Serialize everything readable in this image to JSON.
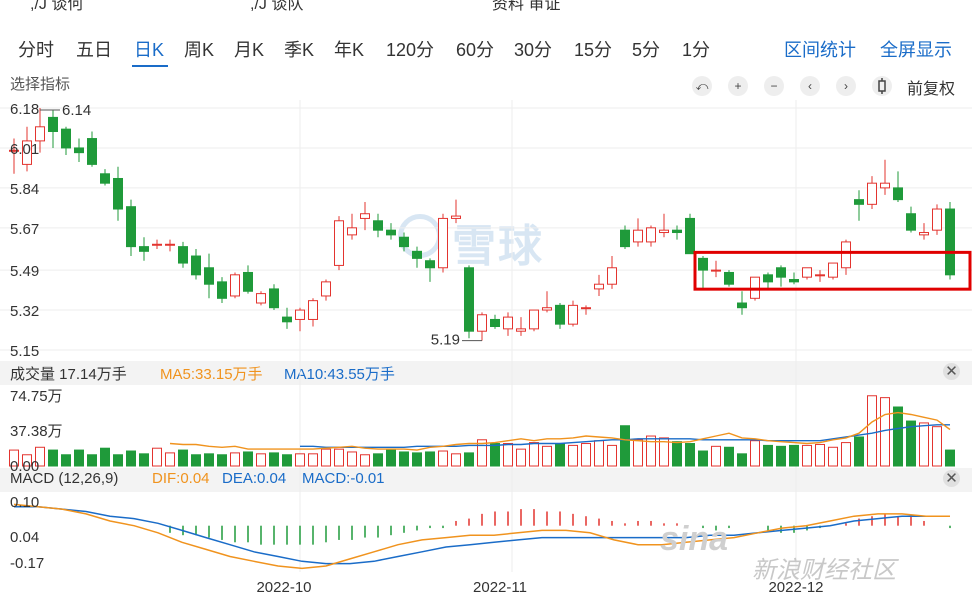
{
  "tabs": [
    "分时",
    "五日",
    "日K",
    "周K",
    "月K",
    "季K",
    "年K",
    "120分",
    "60分",
    "30分",
    "15分",
    "5分",
    "1分"
  ],
  "active_tab": "日K",
  "right_links": {
    "range_stats": "区间统计",
    "fullscreen": "全屏显示"
  },
  "indicator_select": "选择指标",
  "controls": {
    "undo": "⤺",
    "zoom_in": "+",
    "zoom_out": "−",
    "prev": "‹",
    "next": "›"
  },
  "adjust_label": "前复权",
  "volume_bar": {
    "label": "成交量 17.14万手",
    "ma5": "MA5:33.15万手",
    "ma10": "MA10:43.55万手"
  },
  "macd_bar": {
    "label": "MACD (12,26,9)",
    "dif": "DIF:0.04",
    "dea": "DEA:0.04",
    "macd": "MACD:-0.01"
  },
  "watermarks": {
    "xueqiu": "雪球",
    "sina_logo": "sina",
    "sina_text": "新浪财经社区"
  },
  "colors": {
    "up": "#e3342f",
    "down": "#1f9a3a",
    "ma5": "#f0931e",
    "ma10": "#1a6cc8",
    "highlight": "#e00000",
    "accent": "#1a6cc8"
  },
  "chart_data": [
    {
      "type": "candlestick",
      "ylim": [
        5.15,
        6.18
      ],
      "y_ticks": [
        "6.18",
        "6.01",
        "5.84",
        "5.67",
        "5.49",
        "5.32",
        "5.15"
      ],
      "annotations": {
        "high": "6.14",
        "low": "5.19"
      },
      "x_labels": [
        "2022-10",
        "2022-11",
        "2022-12"
      ],
      "ohlc": [
        [
          6.0,
          6.05,
          5.9,
          6.0
        ],
        [
          5.94,
          6.1,
          5.91,
          6.04
        ],
        [
          6.04,
          6.18,
          5.99,
          6.1
        ],
        [
          6.14,
          6.17,
          6.01,
          6.08
        ],
        [
          6.09,
          6.1,
          5.98,
          6.01
        ],
        [
          6.01,
          6.05,
          5.95,
          5.99
        ],
        [
          6.05,
          6.08,
          5.93,
          5.94
        ],
        [
          5.9,
          5.92,
          5.85,
          5.86
        ],
        [
          5.88,
          5.93,
          5.7,
          5.75
        ],
        [
          5.76,
          5.79,
          5.55,
          5.59
        ],
        [
          5.59,
          5.63,
          5.53,
          5.57
        ],
        [
          5.6,
          5.62,
          5.58,
          5.6
        ],
        [
          5.6,
          5.62,
          5.57,
          5.6
        ],
        [
          5.59,
          5.61,
          5.5,
          5.52
        ],
        [
          5.55,
          5.58,
          5.45,
          5.47
        ],
        [
          5.5,
          5.56,
          5.37,
          5.43
        ],
        [
          5.44,
          5.46,
          5.35,
          5.37
        ],
        [
          5.38,
          5.48,
          5.37,
          5.47
        ],
        [
          5.48,
          5.51,
          5.39,
          5.4
        ],
        [
          5.35,
          5.4,
          5.34,
          5.39
        ],
        [
          5.41,
          5.43,
          5.32,
          5.33
        ],
        [
          5.29,
          5.33,
          5.24,
          5.27
        ],
        [
          5.28,
          5.33,
          5.23,
          5.32
        ],
        [
          5.28,
          5.37,
          5.25,
          5.36
        ],
        [
          5.38,
          5.45,
          5.36,
          5.44
        ],
        [
          5.51,
          5.72,
          5.49,
          5.7
        ],
        [
          5.64,
          5.73,
          5.62,
          5.67
        ],
        [
          5.71,
          5.78,
          5.66,
          5.73
        ],
        [
          5.7,
          5.73,
          5.63,
          5.66
        ],
        [
          5.66,
          5.69,
          5.62,
          5.64
        ],
        [
          5.63,
          5.65,
          5.57,
          5.59
        ],
        [
          5.57,
          5.59,
          5.5,
          5.54
        ],
        [
          5.53,
          5.54,
          5.44,
          5.5
        ],
        [
          5.5,
          5.73,
          5.48,
          5.71
        ],
        [
          5.71,
          5.79,
          5.69,
          5.72
        ],
        [
          5.5,
          5.51,
          5.2,
          5.23
        ],
        [
          5.23,
          5.31,
          5.19,
          5.3
        ],
        [
          5.28,
          5.3,
          5.24,
          5.25
        ],
        [
          5.24,
          5.31,
          5.21,
          5.29
        ],
        [
          5.23,
          5.29,
          5.21,
          5.24
        ],
        [
          5.24,
          5.32,
          5.23,
          5.32
        ],
        [
          5.32,
          5.4,
          5.31,
          5.33
        ],
        [
          5.34,
          5.35,
          5.24,
          5.26
        ],
        [
          5.26,
          5.36,
          5.25,
          5.34
        ],
        [
          5.33,
          5.34,
          5.3,
          5.33
        ],
        [
          5.41,
          5.47,
          5.38,
          5.43
        ],
        [
          5.43,
          5.55,
          5.41,
          5.5
        ],
        [
          5.66,
          5.68,
          5.58,
          5.59
        ],
        [
          5.61,
          5.71,
          5.59,
          5.66
        ],
        [
          5.61,
          5.68,
          5.59,
          5.67
        ],
        [
          5.65,
          5.73,
          5.63,
          5.66
        ],
        [
          5.66,
          5.68,
          5.62,
          5.65
        ],
        [
          5.71,
          5.73,
          5.56,
          5.56
        ],
        [
          5.54,
          5.55,
          5.41,
          5.49
        ],
        [
          5.49,
          5.53,
          5.46,
          5.49
        ],
        [
          5.48,
          5.49,
          5.42,
          5.43
        ],
        [
          5.35,
          5.4,
          5.3,
          5.33
        ],
        [
          5.37,
          5.45,
          5.36,
          5.46
        ],
        [
          5.47,
          5.48,
          5.41,
          5.44
        ],
        [
          5.5,
          5.51,
          5.42,
          5.46
        ],
        [
          5.45,
          5.48,
          5.43,
          5.44
        ],
        [
          5.46,
          5.49,
          5.45,
          5.5
        ],
        [
          5.47,
          5.49,
          5.44,
          5.47
        ],
        [
          5.46,
          5.5,
          5.45,
          5.52
        ],
        [
          5.5,
          5.62,
          5.47,
          5.61
        ],
        [
          5.79,
          5.83,
          5.7,
          5.77
        ],
        [
          5.77,
          5.89,
          5.75,
          5.86
        ],
        [
          5.84,
          5.96,
          5.81,
          5.86
        ],
        [
          5.84,
          5.91,
          5.78,
          5.79
        ],
        [
          5.73,
          5.76,
          5.65,
          5.66
        ],
        [
          5.64,
          5.69,
          5.62,
          5.65
        ],
        [
          5.66,
          5.77,
          5.64,
          5.75
        ],
        [
          5.75,
          5.78,
          5.45,
          5.47
        ]
      ],
      "highlight_box": {
        "start_index": 53,
        "end_index": 73,
        "price_range": [
          5.46,
          5.54
        ]
      }
    },
    {
      "type": "bar",
      "name": "volume",
      "unit": "万手",
      "ylim": [
        0,
        74.75
      ],
      "y_ticks": [
        "74.75万",
        "37.38万",
        "0.00"
      ],
      "values": [
        17,
        12,
        20,
        17,
        12,
        17,
        12,
        19,
        12,
        16,
        13,
        19,
        14,
        17,
        12,
        13,
        12,
        14,
        15,
        13,
        14,
        12,
        13,
        13,
        18,
        18,
        15,
        12,
        13,
        17,
        15,
        14,
        15,
        16,
        13,
        14,
        28,
        24,
        24,
        18,
        25,
        21,
        24,
        22,
        24,
        27,
        22,
        43,
        28,
        32,
        30,
        26,
        24,
        16,
        21,
        20,
        13,
        27,
        22,
        21,
        22,
        22,
        23,
        20,
        25,
        31,
        75,
        73,
        63,
        48,
        46,
        42,
        17
      ],
      "ma5": [
        24,
        23,
        23,
        21,
        20,
        21,
        18,
        18,
        18,
        18,
        18,
        18,
        19,
        20,
        21,
        19,
        18,
        18,
        18,
        17,
        20,
        21,
        23,
        24,
        24,
        25,
        27,
        29,
        27,
        29,
        29,
        30,
        32,
        31,
        30,
        28,
        27,
        26,
        26,
        25,
        26,
        29,
        32,
        35,
        30,
        29,
        27,
        26,
        25,
        24,
        25,
        28,
        30,
        35,
        47,
        55,
        57,
        55,
        52,
        49,
        39
      ],
      "ma10": [
        21,
        21,
        20,
        20,
        20,
        20,
        20,
        20,
        20,
        21,
        21,
        21,
        21,
        22,
        22,
        22,
        23,
        23,
        24,
        24,
        24,
        25,
        26,
        27,
        28,
        28,
        29,
        29,
        29,
        29,
        29,
        28,
        28,
        28,
        28,
        28,
        27,
        27,
        27,
        27,
        27,
        29,
        31,
        33,
        35,
        38,
        40,
        42,
        43,
        44,
        44
      ]
    },
    {
      "type": "line",
      "name": "MACD",
      "ylim": [
        -0.17,
        0.1
      ],
      "y_ticks": [
        "0.10",
        "0.04",
        "-0.17"
      ],
      "dif": [
        0.09,
        0.08,
        0.07,
        0.05,
        0.02,
        0.0,
        -0.03,
        -0.07,
        -0.1,
        -0.13,
        -0.15,
        -0.17,
        -0.18,
        -0.17,
        -0.14,
        -0.11,
        -0.08,
        -0.06,
        -0.05,
        -0.04,
        -0.04,
        -0.03,
        -0.02,
        -0.02,
        -0.03,
        -0.06,
        -0.08,
        -0.08,
        -0.07,
        -0.06,
        -0.05,
        -0.03,
        -0.01,
        0.0,
        0.02,
        0.04,
        0.05,
        0.05,
        0.04,
        0.04
      ],
      "dea": [
        0.08,
        0.08,
        0.07,
        0.06,
        0.04,
        0.03,
        0.01,
        -0.02,
        -0.05,
        -0.08,
        -0.11,
        -0.13,
        -0.15,
        -0.16,
        -0.16,
        -0.15,
        -0.13,
        -0.11,
        -0.09,
        -0.08,
        -0.07,
        -0.06,
        -0.05,
        -0.05,
        -0.05,
        -0.05,
        -0.05,
        -0.05,
        -0.05,
        -0.04,
        -0.04,
        -0.03,
        -0.02,
        -0.01,
        0.0,
        0.02,
        0.03,
        0.04,
        0.04,
        0.04
      ],
      "macd": [
        -0.03,
        -0.04,
        -0.04,
        -0.05,
        -0.06,
        -0.07,
        -0.07,
        -0.08,
        -0.08,
        -0.08,
        -0.08,
        -0.08,
        -0.07,
        -0.06,
        -0.06,
        -0.05,
        -0.05,
        -0.04,
        -0.03,
        -0.02,
        -0.01,
        -0.01,
        0.02,
        0.03,
        0.05,
        0.06,
        0.06,
        0.07,
        0.07,
        0.06,
        0.06,
        0.05,
        0.04,
        0.03,
        0.02,
        0.01,
        0.02,
        0.02,
        0.01,
        0.01,
        0.0,
        -0.01,
        -0.02,
        -0.01,
        0.0,
        0.0,
        -0.02,
        -0.03,
        -0.03,
        -0.02,
        -0.01,
        0.0,
        0.01,
        0.03,
        0.04,
        0.05,
        0.04,
        0.04,
        0.02,
        0.0,
        -0.01
      ]
    }
  ]
}
